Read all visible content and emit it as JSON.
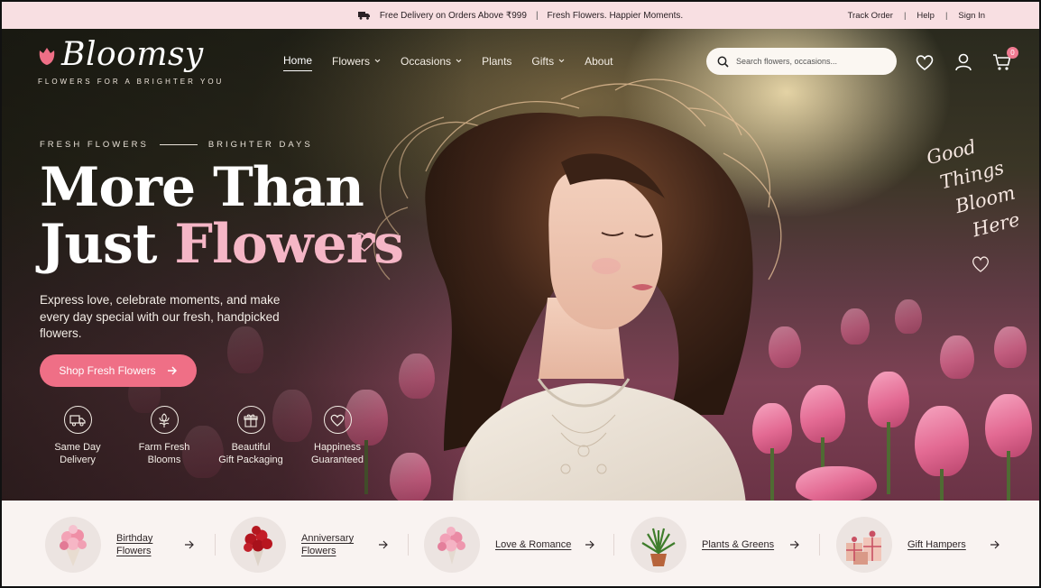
{
  "announcement": {
    "delivery": "Free Delivery on Orders Above ₹999",
    "separator": "|",
    "tagline": "Fresh Flowers. Happier Moments.",
    "links": [
      "Track Order",
      "Help",
      "Sign In"
    ]
  },
  "brand": {
    "name": "Bloomsy",
    "tagline": "FLOWERS FOR A BRIGHTER YOU",
    "accent_color": "#ef6f86",
    "pink_text_color": "#f5b6c6"
  },
  "nav": {
    "items": [
      {
        "label": "Home",
        "active": true,
        "dropdown": false
      },
      {
        "label": "Flowers",
        "active": false,
        "dropdown": true
      },
      {
        "label": "Occasions",
        "active": false,
        "dropdown": true
      },
      {
        "label": "Plants",
        "active": false,
        "dropdown": false
      },
      {
        "label": "Gifts",
        "active": false,
        "dropdown": true
      },
      {
        "label": "About",
        "active": false,
        "dropdown": false
      }
    ]
  },
  "search": {
    "placeholder": "Search flowers, occasions..."
  },
  "header_icons": {
    "wishlist": "heart-icon",
    "account": "user-icon",
    "cart": "cart-icon",
    "cart_count": "0"
  },
  "hero": {
    "eyebrow_left": "FRESH FLOWERS",
    "eyebrow_right": "BRIGHTER DAYS",
    "headline_line1": "More Than",
    "headline_line2_start": "Just ",
    "headline_line2_pink": "Flowers",
    "subcopy": "Express love, celebrate moments, and make every day special with our fresh, handpicked flowers.",
    "cta_label": "Shop Fresh Flowers",
    "script_lines": [
      "Good",
      "Things",
      "Bloom",
      "Here"
    ]
  },
  "features": [
    {
      "label": "Same Day\nDelivery",
      "icon": "truck-icon"
    },
    {
      "label": "Farm Fresh\nBlooms",
      "icon": "flower-icon"
    },
    {
      "label": "Beautiful\nGift Packaging",
      "icon": "gift-icon"
    },
    {
      "label": "Happiness\nGuaranteed",
      "icon": "heart-icon"
    }
  ],
  "categories": [
    {
      "label": "Birthday\nFlowers",
      "icon": "pink-bouquet"
    },
    {
      "label": "Anniversary\nFlowers",
      "icon": "red-rose-bouquet"
    },
    {
      "label": "Love & Romance",
      "icon": "pink-rose-bouquet"
    },
    {
      "label": "Plants & Greens",
      "icon": "potted-plant"
    },
    {
      "label": "Gift Hampers",
      "icon": "gift-hamper"
    }
  ]
}
